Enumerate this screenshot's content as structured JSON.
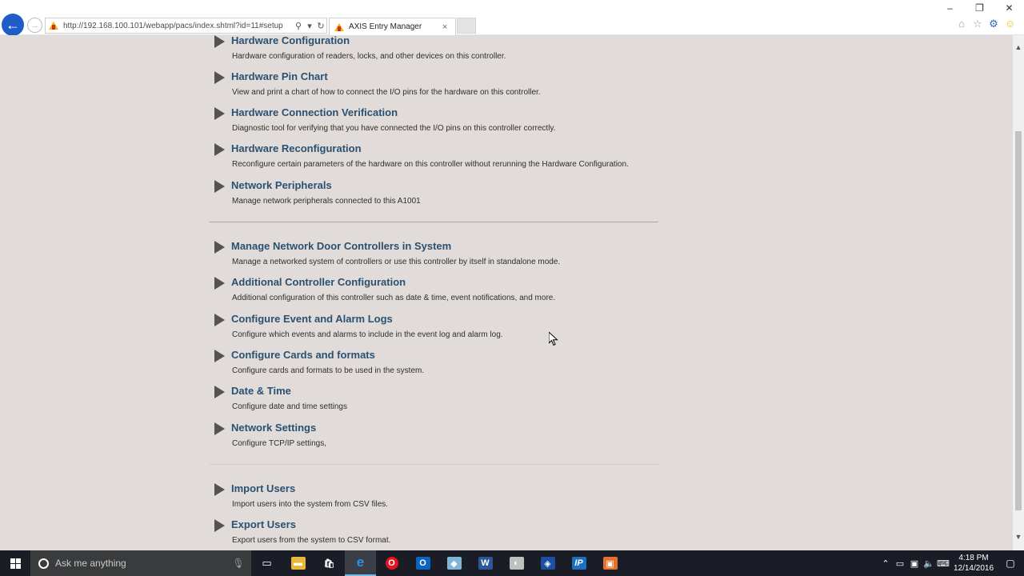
{
  "browser": {
    "url": "http://192.168.100.101/webapp/pacs/index.shtml?id=11#setup",
    "tab_title": "AXIS Entry Manager",
    "tab_close": "×",
    "window_controls": [
      "–",
      "❐",
      "✕"
    ]
  },
  "menu": {
    "group1": [
      {
        "title": "Hardware Configuration",
        "desc": "Hardware configuration of readers, locks, and other devices on this controller."
      },
      {
        "title": "Hardware Pin Chart",
        "desc": "View and print a chart of how to connect the I/O pins for the hardware on this controller."
      },
      {
        "title": "Hardware Connection Verification",
        "desc": "Diagnostic tool for verifying that you have connected the I/O pins on this controller correctly."
      },
      {
        "title": "Hardware Reconfiguration",
        "desc": "Reconfigure certain parameters of the hardware on this controller without rerunning the Hardware Configuration."
      },
      {
        "title": "Network Peripherals",
        "desc": "Manage network peripherals connected to this A1001"
      }
    ],
    "group2": [
      {
        "title": "Manage Network Door Controllers in System",
        "desc": "Manage a networked system of controllers or use this controller by itself in standalone mode."
      },
      {
        "title": "Additional Controller Configuration",
        "desc": "Additional configuration of this controller such as date & time, event notifications, and more."
      },
      {
        "title": "Configure Event and Alarm Logs",
        "desc": "Configure which events and alarms to include in the event log and alarm log."
      },
      {
        "title": "Configure Cards and formats",
        "desc": "Configure cards and formats to be used in the system."
      },
      {
        "title": "Date & Time",
        "desc": "Configure date and time settings"
      },
      {
        "title": "Network Settings",
        "desc": "Configure TCP/IP settings,"
      }
    ],
    "group3": [
      {
        "title": "Import Users",
        "desc": "Import users into the system from CSV files."
      },
      {
        "title": "Export Users",
        "desc": "Export users from the system to CSV format."
      }
    ]
  },
  "taskbar": {
    "search_placeholder": "Ask me anything",
    "apps": [
      "file-explorer",
      "store",
      "edge-ie",
      "opera",
      "outlook",
      "app-blue",
      "word",
      "paint",
      "app-shield",
      "ip-app",
      "app-orange"
    ],
    "time": "4:18 PM",
    "date": "12/14/2016"
  },
  "colors": {
    "page_bg": "#e1dbd9",
    "link": "#2a5172",
    "taskbar_bg": "#1a1d25",
    "back_button": "#1e5cc7"
  }
}
